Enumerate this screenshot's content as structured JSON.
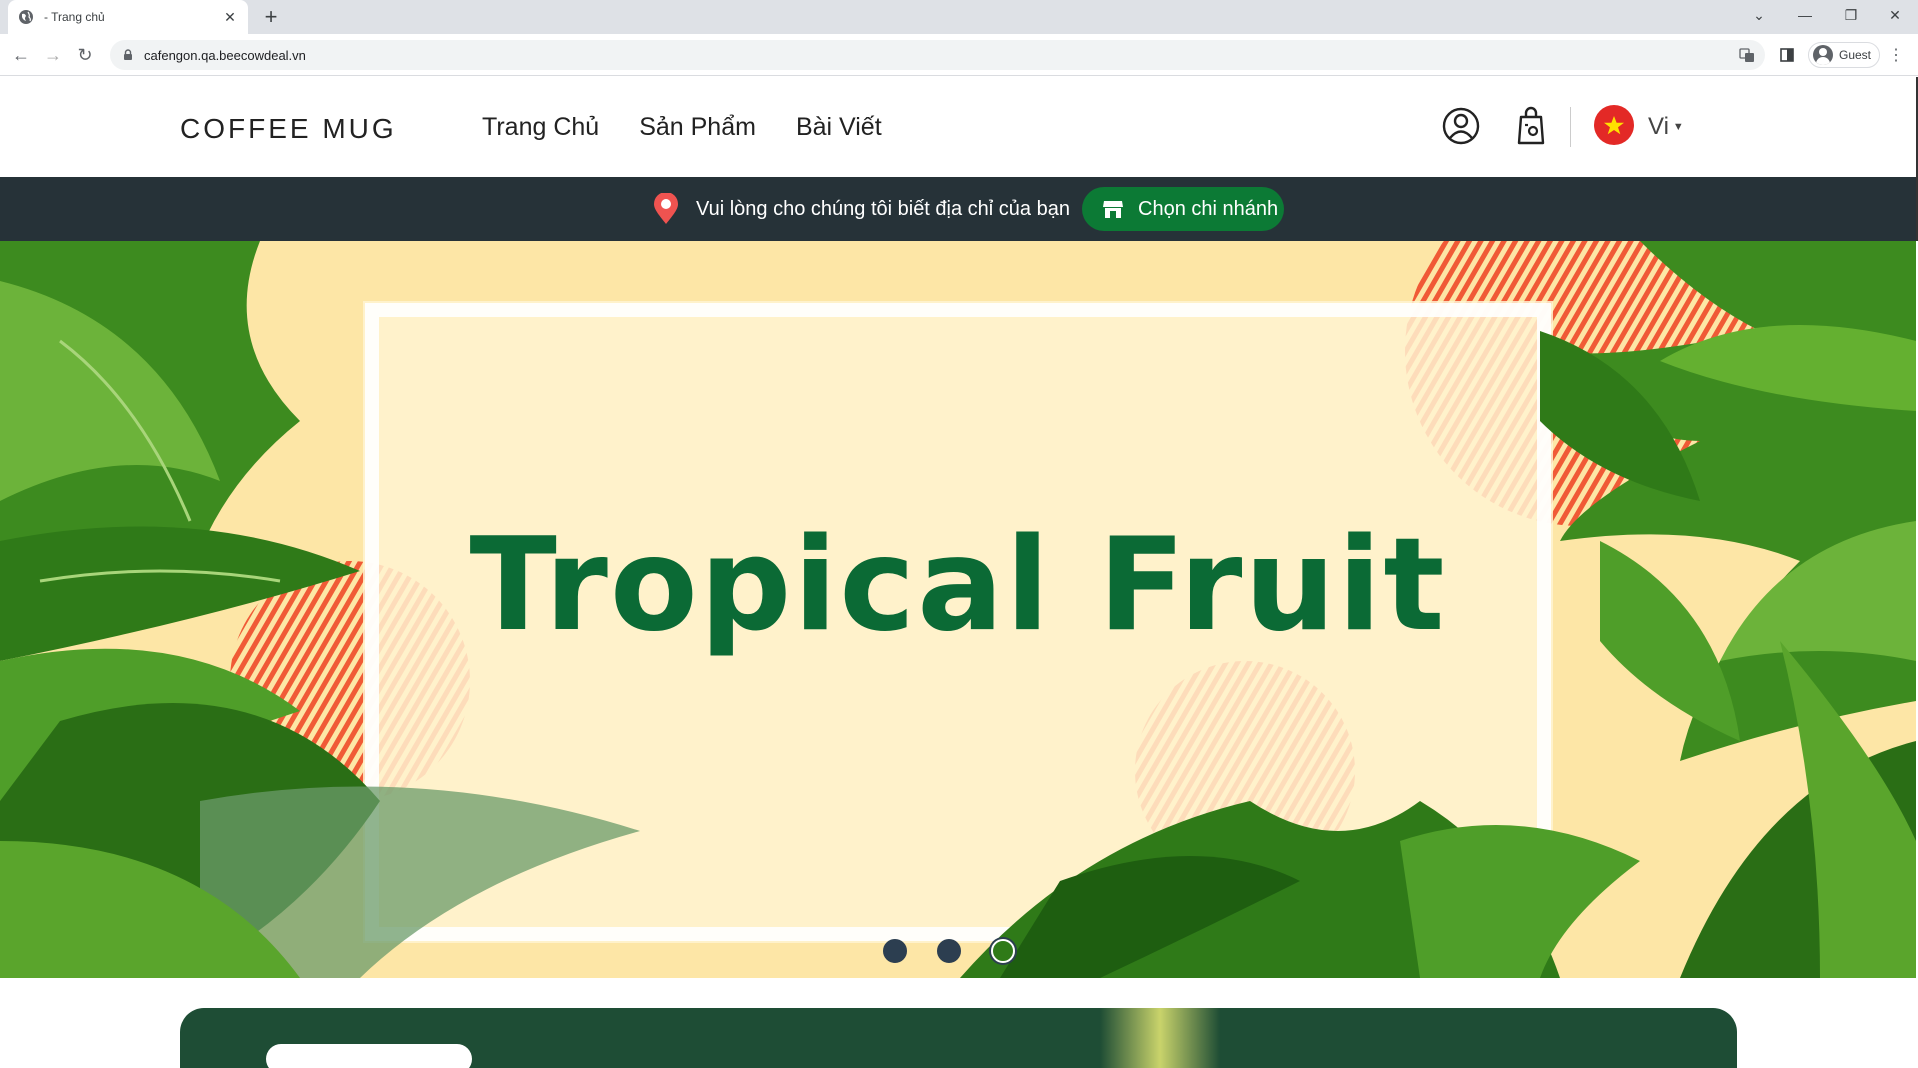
{
  "browser": {
    "tab_title": "- Trang chủ",
    "url": "cafengon.qa.beecowdeal.vn",
    "profile_label": "Guest"
  },
  "header": {
    "logo": "COFFEE MUG",
    "nav": [
      "Trang Chủ",
      "Sản Phẩm",
      "Bài Viết"
    ],
    "language": "Vi",
    "icons": [
      "user-circle-icon",
      "shopping-bag-icon",
      "vietnam-flag-icon"
    ]
  },
  "location_bar": {
    "message": "Vui lòng cho chúng tôi biết địa chỉ của bạn",
    "button_label": "Chọn chi nhánh"
  },
  "hero": {
    "title": "Tropical Fruit",
    "slides_total": 3,
    "active_slide": 3
  },
  "colors": {
    "brand_green": "#0c7a35",
    "title_green": "#0b6a35",
    "dark_bar": "#263238",
    "hero_bg": "#fde6a6",
    "accent_red": "#e32926"
  }
}
